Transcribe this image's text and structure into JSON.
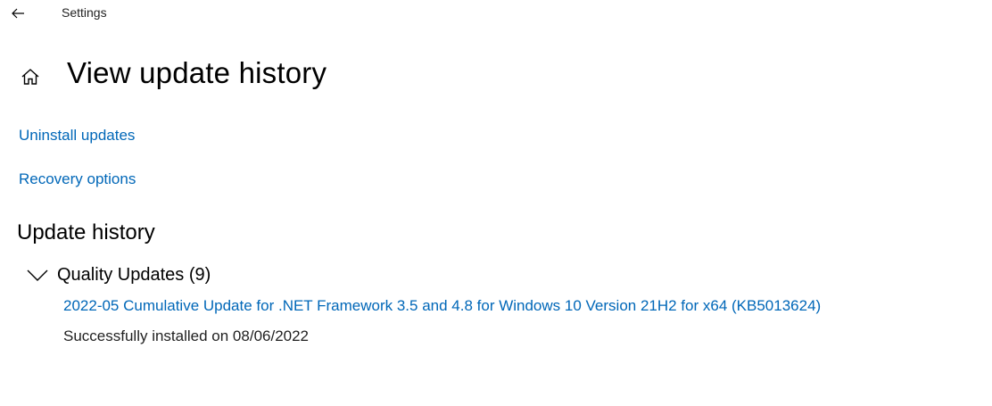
{
  "window": {
    "title": "Settings",
    "back_icon": "back-arrow-icon"
  },
  "page": {
    "home_icon": "home-icon",
    "title": "View update history"
  },
  "links": {
    "uninstall": "Uninstall updates",
    "recovery": "Recovery options"
  },
  "history": {
    "title": "Update history",
    "groups": [
      {
        "label": "Quality Updates (9)",
        "expanded": true,
        "items": [
          {
            "name": "2022-05 Cumulative Update for .NET Framework 3.5 and 4.8 for Windows 10 Version 21H2 for x64 (KB5013624)",
            "status": "Successfully installed on 08/06/2022"
          }
        ]
      }
    ]
  },
  "colors": {
    "link": "#0067b8",
    "text": "#000000",
    "background": "#ffffff"
  }
}
